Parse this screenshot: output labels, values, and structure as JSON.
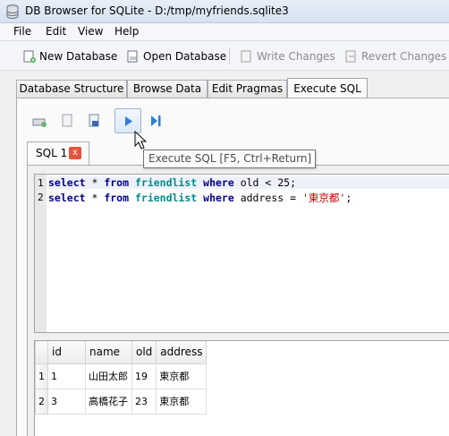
{
  "window": {
    "title": "DB Browser for SQLite - D:/tmp/myfriends.sqlite3"
  },
  "menu": [
    "File",
    "Edit",
    "View",
    "Help"
  ],
  "toolbar": {
    "new_database": "New Database",
    "open_database": "Open Database",
    "write_changes": "Write Changes",
    "revert_changes": "Revert Changes"
  },
  "tabs": [
    "Database Structure",
    "Browse Data",
    "Edit Pragmas",
    "Execute SQL"
  ],
  "active_tab": "Execute SQL",
  "sql_tab": {
    "label": "SQL 1",
    "close": "x"
  },
  "tooltip": "Execute SQL [F5, Ctrl+Return]",
  "editor": {
    "lines": [
      {
        "no": "1",
        "text": "select * from friendlist where old < 25;"
      },
      {
        "no": "2",
        "text": "select * from friendlist where address = '東京都';"
      }
    ]
  },
  "results": {
    "columns": [
      "id",
      "name",
      "old",
      "address"
    ],
    "rows": [
      {
        "row": "1",
        "cells": [
          "1",
          "山田太郎",
          "19",
          "東京都"
        ]
      },
      {
        "row": "2",
        "cells": [
          "3",
          "高橋花子",
          "23",
          "東京都"
        ]
      }
    ]
  },
  "colors": {
    "keyword": "#00008b",
    "table": "#008b8b",
    "string": "#c00000",
    "close_button": "#e6543c"
  }
}
